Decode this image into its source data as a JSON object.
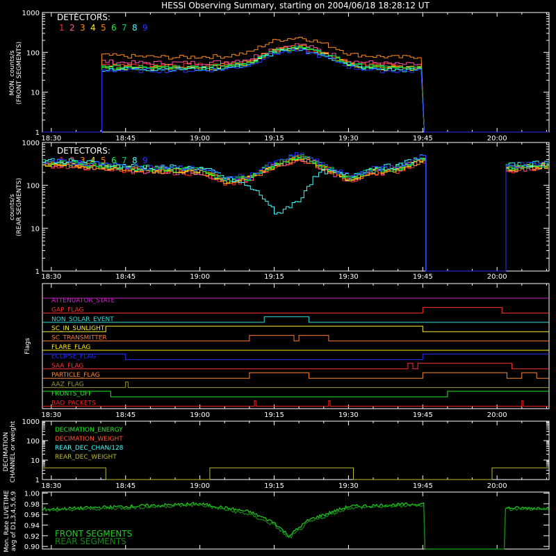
{
  "title": "HESSI Observing Summary, starting on 2004/06/18 18:28:12 UT",
  "colors": {
    "background": "#000000",
    "axes": "#ffffff",
    "det1": "#ff2d2d",
    "det2": "#ff55aa",
    "det3": "#ff8c1a",
    "det4": "#ffee00",
    "det5": "#ff8800",
    "det6": "#00ff33",
    "det7": "#00cc66",
    "det8": "#44ffff",
    "det9": "#2a33ff"
  },
  "time_ticks": [
    "18:30",
    "18:45",
    "19:00",
    "19:15",
    "19:30",
    "19:45",
    "20:00"
  ],
  "panel1": {
    "ylabel_line1": "MON. counts/s",
    "ylabel_line2": "(FRONT SEGMENTS)",
    "legend_title": "DETECTORS:",
    "y_ticks": [
      "1",
      "10",
      "100",
      "1000"
    ]
  },
  "panel2": {
    "ylabel_line1": "counts/s",
    "ylabel_line2": "(REAR SEGMENTS)",
    "legend_title": "DETECTORS:",
    "y_ticks": [
      "1",
      "10",
      "100",
      "1000"
    ]
  },
  "detector_numbers": [
    "1",
    "2",
    "3",
    "4",
    "5",
    "6",
    "7",
    "8",
    "9"
  ],
  "panel3": {
    "ylabel": "Flags",
    "flags": [
      {
        "label": "ATTENUATOR_STATE",
        "color": "#cc22cc"
      },
      {
        "label": "GAP_FLAG",
        "color": "#ff3322"
      },
      {
        "label": "NON_SOLAR_EVENT",
        "color": "#33dddd"
      },
      {
        "label": "SC_IN_SUNLIGHT",
        "color": "#ffee33"
      },
      {
        "label": "SC_TRANSMITTER",
        "color": "#ff7733"
      },
      {
        "label": "FLARE_FLAG",
        "color": "#ffee00"
      },
      {
        "label": "ECLIPSE_FLAG",
        "color": "#2233ff"
      },
      {
        "label": "SAA_FLAG",
        "color": "#ff3333"
      },
      {
        "label": "PARTICLE_FLAG",
        "color": "#ff8833"
      },
      {
        "label": "AAZ_FLAG",
        "color": "#999933"
      },
      {
        "label": "FRONTS_OFF",
        "color": "#22ee22"
      },
      {
        "label": "BAD_PACKETS",
        "color": "#ff2222"
      }
    ]
  },
  "panel4": {
    "ylabel_line1": "DECIMATION",
    "ylabel_line2": "CHANNEL or weight",
    "y_ticks": [
      "1",
      "10",
      "100",
      "1000"
    ],
    "legend": [
      {
        "label": "DECIMATION_ENERGY",
        "color": "#22ee22"
      },
      {
        "label": "DECIMATION_WEIGHT",
        "color": "#ff5533"
      },
      {
        "label": "REAR_DEC_CHAN/128",
        "color": "#44ffff"
      },
      {
        "label": "REAR_DEC_WEIGHT",
        "color": "#bbbb33"
      }
    ]
  },
  "panel5": {
    "ylabel_line1": "Mon. Rate LIVETIME",
    "ylabel_line2": "avg of D1,3,4,5,6,9",
    "y_ticks": [
      "0.90",
      "0.92",
      "0.94",
      "0.96",
      "0.98",
      "1.00"
    ],
    "legend": [
      {
        "label": "FRONT SEGMENTS",
        "color": "#22cc22"
      },
      {
        "label": "REAR SEGMENTS",
        "color": "#118811"
      }
    ]
  },
  "chart_data": [
    {
      "type": "line",
      "title": "HESSI Observing Summary, starting on 2004/06/18 18:28:12 UT",
      "ylabel": "MON. counts/s (FRONT SEGMENTS)",
      "yscale": "log",
      "ylim": [
        1,
        1000
      ],
      "xlim": [
        "18:28:12",
        "20:10"
      ],
      "x": [
        "18:40",
        "18:45",
        "18:55",
        "19:00",
        "19:05",
        "19:10",
        "19:15",
        "19:20",
        "19:25",
        "19:30",
        "19:35",
        "19:40",
        "19:45"
      ],
      "series": [
        {
          "name": "1",
          "values": [
            50,
            50,
            48,
            48,
            50,
            60,
            110,
            130,
            90,
            55,
            50,
            45,
            45
          ]
        },
        {
          "name": "2",
          "values": [
            60,
            55,
            55,
            55,
            58,
            70,
            130,
            160,
            100,
            60,
            55,
            50,
            50
          ]
        },
        {
          "name": "3",
          "values": [
            85,
            80,
            75,
            78,
            80,
            100,
            200,
            240,
            160,
            90,
            80,
            75,
            80
          ]
        },
        {
          "name": "4",
          "values": [
            40,
            40,
            40,
            40,
            42,
            55,
            110,
            140,
            90,
            50,
            40,
            40,
            40
          ]
        },
        {
          "name": "5",
          "values": [
            45,
            45,
            45,
            45,
            48,
            60,
            115,
            150,
            95,
            52,
            45,
            42,
            42
          ]
        },
        {
          "name": "6",
          "values": [
            42,
            42,
            42,
            42,
            44,
            55,
            105,
            130,
            85,
            48,
            42,
            40,
            40
          ]
        },
        {
          "name": "7",
          "values": [
            44,
            44,
            44,
            44,
            46,
            56,
            108,
            135,
            88,
            50,
            44,
            40,
            40
          ]
        },
        {
          "name": "8",
          "values": [
            38,
            38,
            38,
            38,
            40,
            50,
            100,
            120,
            80,
            45,
            38,
            36,
            36
          ]
        },
        {
          "name": "9",
          "values": [
            35,
            35,
            35,
            35,
            38,
            48,
            95,
            110,
            75,
            42,
            35,
            34,
            34
          ]
        }
      ]
    },
    {
      "type": "line",
      "ylabel": "counts/s (REAR SEGMENTS)",
      "yscale": "log",
      "ylim": [
        1,
        1000
      ],
      "x": [
        "18:30",
        "18:40",
        "18:45",
        "18:55",
        "19:00",
        "19:05",
        "19:10",
        "19:15",
        "19:20",
        "19:25",
        "19:30",
        "19:35",
        "19:40",
        "19:45",
        "20:01",
        "20:10"
      ],
      "series": [
        {
          "name": "1-9",
          "values": [
            330,
            280,
            250,
            230,
            220,
            130,
            150,
            300,
            480,
            250,
            140,
            220,
            250,
            420,
            250,
            300
          ]
        },
        {
          "name": "8",
          "values": [
            350,
            300,
            260,
            240,
            230,
            140,
            80,
            18,
            40,
            200,
            150,
            240,
            260,
            450,
            260,
            310
          ]
        }
      ]
    },
    {
      "type": "table",
      "ylabel": "Flags",
      "categories": [
        "ATTENUATOR_STATE",
        "GAP_FLAG",
        "NON_SOLAR_EVENT",
        "SC_IN_SUNLIGHT",
        "SC_TRANSMITTER",
        "FLARE_FLAG",
        "ECLIPSE_FLAG",
        "SAA_FLAG",
        "PARTICLE_FLAG",
        "AAZ_FLAG",
        "FRONTS_OFF",
        "BAD_PACKETS"
      ]
    },
    {
      "type": "line",
      "ylabel": "DECIMATION CHANNEL or weight",
      "yscale": "log",
      "ylim": [
        1,
        1000
      ],
      "series": [
        {
          "name": "REAR_DEC_WEIGHT",
          "x": [
            "18:28:12",
            "18:41",
            "18:41",
            "19:02",
            "19:02",
            "19:31",
            "19:31",
            "19:59",
            "19:59",
            "20:10"
          ],
          "values": [
            4,
            4,
            1,
            1,
            4,
            4,
            1,
            1,
            4,
            4
          ]
        }
      ]
    },
    {
      "type": "line",
      "ylabel": "Mon. Rate LIVETIME avg of D1,3,4,5,6,9",
      "ylim": [
        0.9,
        1.0
      ],
      "x": [
        "18:30",
        "18:45",
        "19:00",
        "19:10",
        "19:15",
        "19:18",
        "19:22",
        "19:30",
        "19:45",
        "20:02",
        "20:10"
      ],
      "series": [
        {
          "name": "FRONT SEGMENTS",
          "values": [
            0.97,
            0.975,
            0.98,
            0.965,
            0.945,
            0.92,
            0.95,
            0.975,
            0.98,
            0.972,
            0.972
          ]
        },
        {
          "name": "REAR SEGMENTS",
          "values": [
            0.968,
            0.972,
            0.978,
            0.96,
            0.94,
            0.915,
            0.945,
            0.972,
            0.978,
            0.97,
            0.97
          ]
        }
      ]
    }
  ]
}
